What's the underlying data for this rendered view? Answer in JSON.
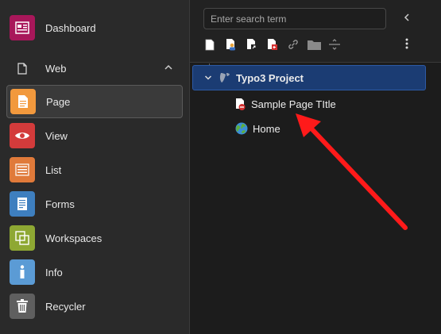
{
  "modules": {
    "dashboard": {
      "label": "Dashboard",
      "icon": "dashboard-icon",
      "color": "#a8175a"
    },
    "web_group": {
      "label": "Web",
      "icon": "page-outline-icon"
    },
    "items": [
      {
        "label": "Page",
        "icon": "page-icon",
        "color": "#f2993d"
      },
      {
        "label": "View",
        "icon": "eye-icon",
        "color": "#d33b3b"
      },
      {
        "label": "List",
        "icon": "list-icon",
        "color": "#e07a3a"
      },
      {
        "label": "Forms",
        "icon": "form-icon",
        "color": "#3e7fbf"
      },
      {
        "label": "Workspaces",
        "icon": "workspaces-icon",
        "color": "#8ea833"
      },
      {
        "label": "Info",
        "icon": "info-icon",
        "color": "#5b9bd5"
      },
      {
        "label": "Recycler",
        "icon": "trash-icon",
        "color": "#5f5f5f"
      }
    ]
  },
  "tree": {
    "search_placeholder": "Enter search term",
    "toolbar_icons": [
      "new-page-icon",
      "page-user-icon",
      "page-shortcut-icon",
      "page-external-icon",
      "link-icon",
      "folder-icon",
      "divider-icon"
    ],
    "root": {
      "label": "Typo3 Project",
      "icon": "typo3-logo-icon"
    },
    "children": [
      {
        "label": "Sample Page TItle",
        "icon": "page-disabled-icon"
      },
      {
        "label": "Home",
        "icon": "globe-icon"
      }
    ]
  },
  "annotation": {
    "color": "#ff1a1a"
  }
}
